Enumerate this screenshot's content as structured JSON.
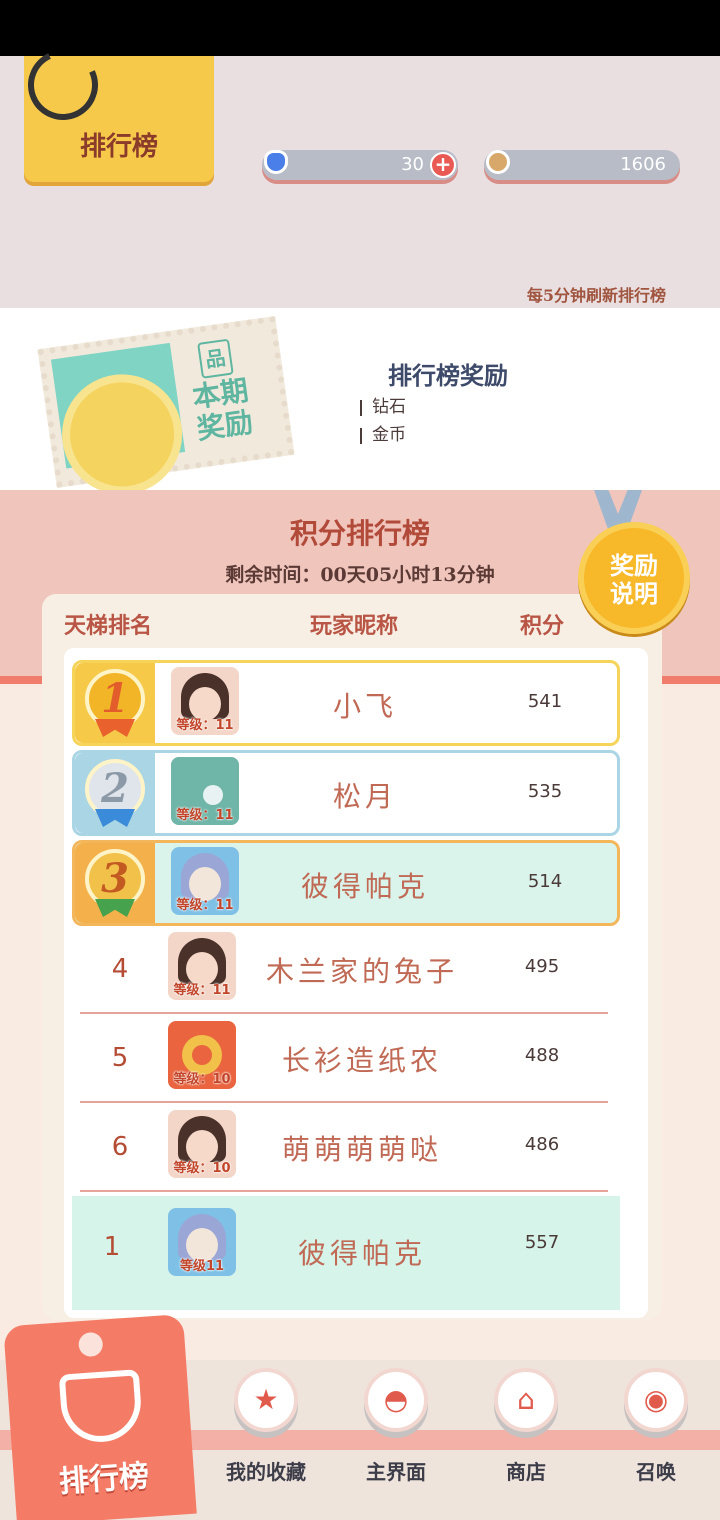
{
  "header": {
    "tab_title": "排行榜",
    "diamonds": "30",
    "coins": "1606",
    "refresh_note": "每5分钟刷新排行榜"
  },
  "reward": {
    "stamp_tag": "品",
    "stamp_line1": "本期",
    "stamp_line2": "奖励",
    "title": "排行榜奖励",
    "diamond_label": "钻石",
    "coin_label": "金币"
  },
  "board": {
    "title": "积分排行榜",
    "timer": "剩余时间：00天05小时13分钟",
    "badge_line1": "奖励",
    "badge_line2": "说明",
    "col_rank": "天梯排名",
    "col_name": "玩家昵称",
    "col_score": "积分",
    "rows": [
      {
        "rank": "1",
        "name": "小飞",
        "score": "541",
        "level": "等级：11"
      },
      {
        "rank": "2",
        "name": "松月",
        "score": "535",
        "level": "等级：11"
      },
      {
        "rank": "3",
        "name": "彼得帕克",
        "score": "514",
        "level": "等级：11"
      },
      {
        "rank": "4",
        "name": "木兰家的兔子",
        "score": "495",
        "level": "等级：11"
      },
      {
        "rank": "5",
        "name": "长衫造纸农",
        "score": "488",
        "level": "等级：10"
      },
      {
        "rank": "6",
        "name": "萌萌萌萌哒",
        "score": "486",
        "level": "等级：10"
      }
    ],
    "self": {
      "rank": "1",
      "name": "彼得帕克",
      "score": "557",
      "level": "等级11"
    }
  },
  "nav": {
    "active": "排行榜",
    "items": [
      "我的收藏",
      "主界面",
      "商店",
      "召唤"
    ]
  },
  "colors": {
    "accent": "#f47c67",
    "gold": "#f6ca48",
    "teal": "#d6f4ea"
  }
}
